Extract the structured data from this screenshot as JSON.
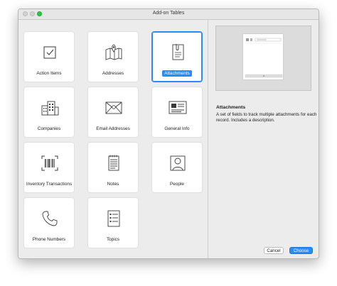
{
  "window": {
    "title": "Add-on Tables"
  },
  "tables": [
    {
      "label": "Action Items",
      "icon": "checkbox-icon"
    },
    {
      "label": "Addresses",
      "icon": "map-icon"
    },
    {
      "label": "Attachments",
      "icon": "paperclip-document-icon"
    },
    {
      "label": "Companies",
      "icon": "buildings-icon"
    },
    {
      "label": "Email Addresses",
      "icon": "envelope-icon"
    },
    {
      "label": "General Info",
      "icon": "info-card-icon"
    },
    {
      "label": "Inventory Transactions",
      "icon": "barcode-icon"
    },
    {
      "label": "Notes",
      "icon": "notepad-icon"
    },
    {
      "label": "People",
      "icon": "person-icon"
    },
    {
      "label": "Phone Numbers",
      "icon": "phone-icon"
    },
    {
      "label": "Topics",
      "icon": "list-document-icon"
    }
  ],
  "selected_index": 2,
  "detail": {
    "title": "Attachments",
    "description": "A set of fields to track multiple attachments for each record. Includes a description."
  },
  "buttons": {
    "cancel": "Cancel",
    "choose": "Choose"
  },
  "colors": {
    "accent": "#2c8af5",
    "icon_stroke": "#3a3a3a"
  }
}
